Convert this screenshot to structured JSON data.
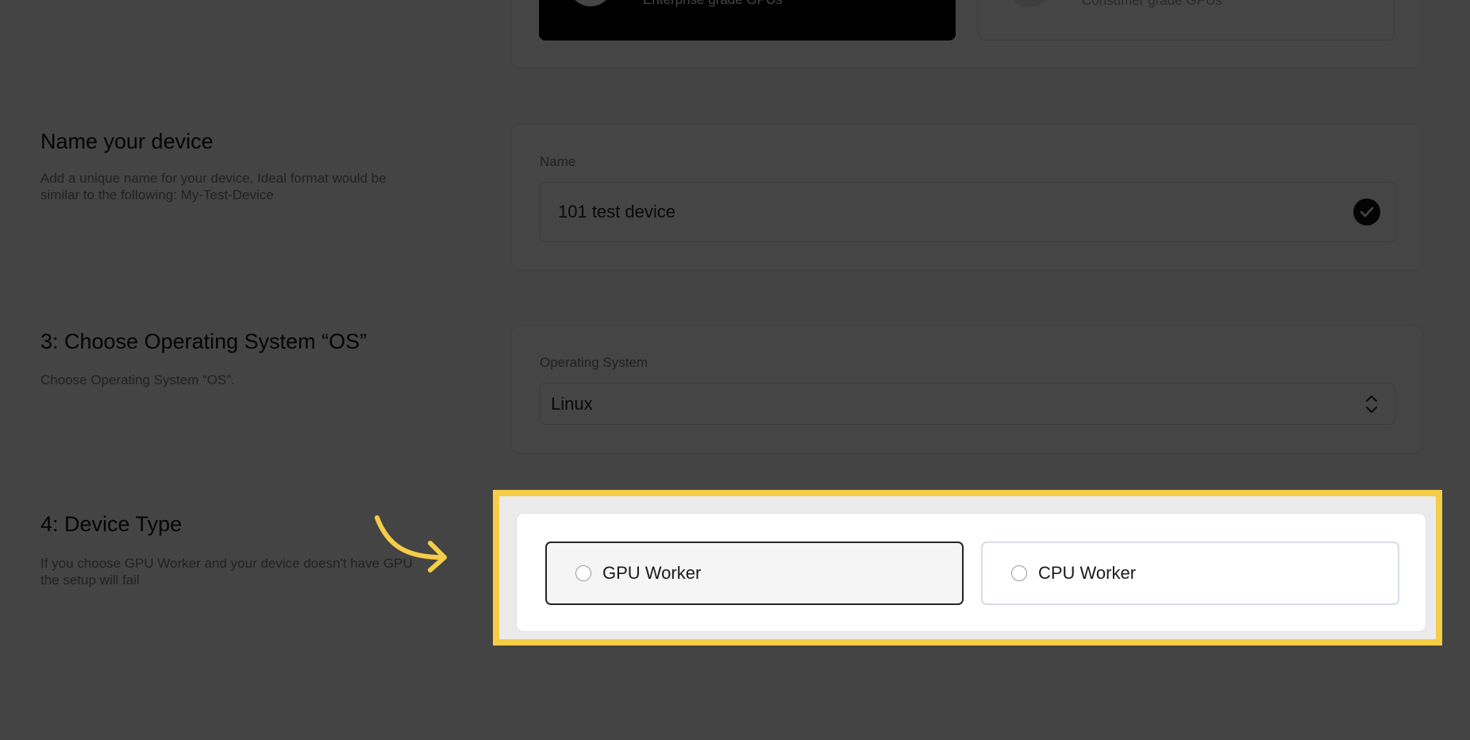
{
  "gpu_type": {
    "enterprise_caption": "Enterprise grade GPUs",
    "consumer_caption": "Consumer grade GPUs"
  },
  "name_section": {
    "title": "Name your device",
    "description_line1": "Add a unique name for your device, Ideal format would be",
    "description_line2": "similar to the following: My-Test-Device",
    "field_label": "Name",
    "value": "101 test device",
    "status_icon": "check-circle-icon"
  },
  "os_section": {
    "title": "3: Choose Operating System “OS”",
    "description": "Choose Operating System “OS”.",
    "field_label": "Operating System",
    "selected": "Linux",
    "control_icon": "chevron-up-down-icon"
  },
  "device_type_section": {
    "title": "4: Device Type",
    "description_line1": "If you choose GPU Worker and your device doesn't have GPU",
    "description_line2": "the setup will fail",
    "options": [
      {
        "label": "GPU Worker",
        "selected": false
      },
      {
        "label": "CPU Worker",
        "selected": false
      }
    ]
  },
  "annotation": {
    "highlight_color": "#f5cd47",
    "arrow_icon": "curved-arrow-icon"
  }
}
